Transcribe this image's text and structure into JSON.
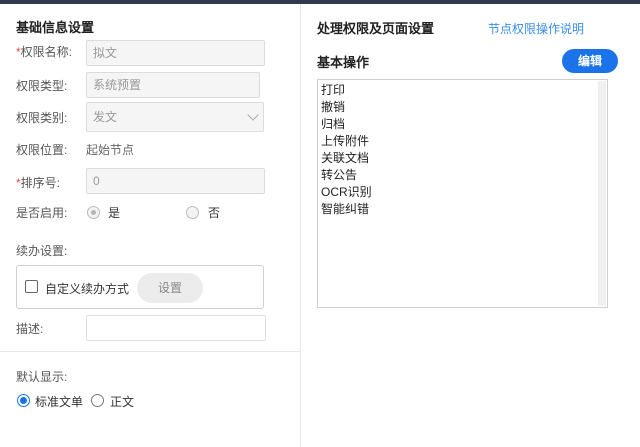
{
  "basic": {
    "title": "基础信息设置",
    "name_req": "*",
    "name_label": "权限名称:",
    "name_value": "拟文",
    "type_label": "权限类型:",
    "type_value": "系统预置",
    "category_label": "权限类别:",
    "category_value": "发文",
    "position_label": "权限位置:",
    "position_value": "起始节点",
    "order_req": "*",
    "order_label": "排序号:",
    "order_value": "0",
    "enabled_label": "是否启用:",
    "enabled_yes": "是",
    "enabled_no": "否",
    "continue_label": "续办设置:",
    "custom_continue": "自定义续办方式",
    "settings_button": "设置",
    "desc_label": "描述:",
    "desc_value": ""
  },
  "display": {
    "label": "默认显示:",
    "option_standard": "标准文单",
    "option_body": "正文"
  },
  "right": {
    "title": "处理权限及页面设置",
    "help_link": "节点权限操作说明",
    "basic_ops_title": "基本操作",
    "edit_button": "编辑",
    "operations": [
      "打印",
      "撤销",
      "归档",
      "上传附件",
      "关联文档",
      "转公告",
      "OCR识别",
      "智能纠错"
    ]
  },
  "colors": {
    "accent": "#1a73e8",
    "link": "#3a8ee6",
    "required": "#e04b4b"
  }
}
